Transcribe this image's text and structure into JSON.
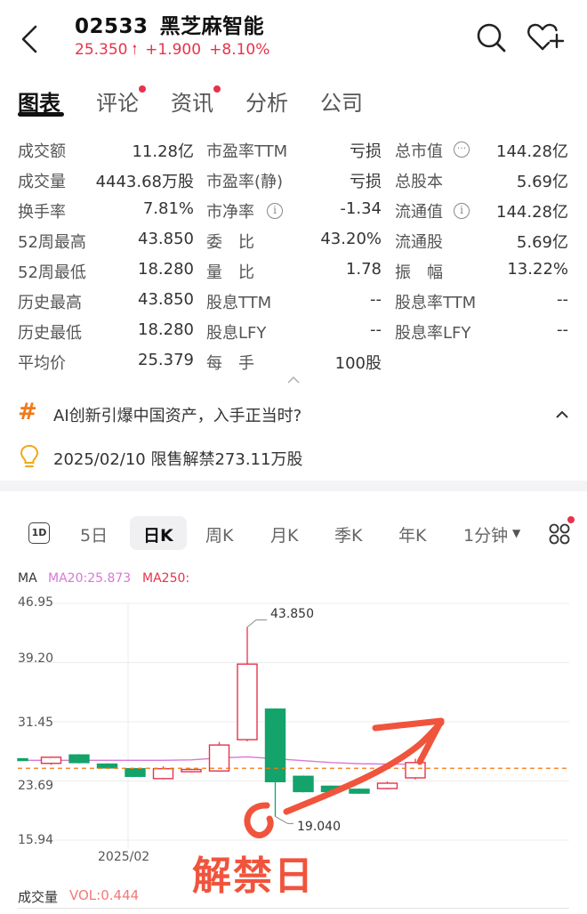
{
  "header": {
    "code": "02533",
    "name": "黑芝麻智能",
    "price": "25.350",
    "change": "+1.900",
    "change_pct": "+8.10%"
  },
  "tabs": [
    {
      "label": "图表",
      "active": true,
      "dot": false
    },
    {
      "label": "评论",
      "active": false,
      "dot": true
    },
    {
      "label": "资讯",
      "active": false,
      "dot": true
    },
    {
      "label": "分析",
      "active": false,
      "dot": false
    },
    {
      "label": "公司",
      "active": false,
      "dot": false
    }
  ],
  "stats": [
    [
      {
        "label": "成交额",
        "value": "11.28亿"
      },
      {
        "label": "市盈率TTM",
        "value": "亏损"
      },
      {
        "label": "总市值",
        "value": "144.28亿"
      }
    ],
    [
      {
        "label": "成交量",
        "value": "4443.68万股"
      },
      {
        "label": "市盈率(静)",
        "value": "亏损"
      },
      {
        "label": "总股本",
        "value": "5.69亿"
      }
    ],
    [
      {
        "label": "换手率",
        "value": "7.81%"
      },
      {
        "label": "市净率",
        "value": "-1.34"
      },
      {
        "label": "流通值",
        "value": "144.28亿"
      }
    ],
    [
      {
        "label": "52周最高",
        "value": "43.850"
      },
      {
        "label": "委　比",
        "value": "43.20%"
      },
      {
        "label": "流通股",
        "value": "5.69亿"
      }
    ],
    [
      {
        "label": "52周最低",
        "value": "18.280"
      },
      {
        "label": "量　比",
        "value": "1.78"
      },
      {
        "label": "振　幅",
        "value": "13.22%"
      }
    ],
    [
      {
        "label": "历史最高",
        "value": "43.850"
      },
      {
        "label": "股息TTM",
        "value": "--"
      },
      {
        "label": "股息率TTM",
        "value": "--"
      }
    ],
    [
      {
        "label": "历史最低",
        "value": "18.280"
      },
      {
        "label": "股息LFY",
        "value": "--"
      },
      {
        "label": "股息率LFY",
        "value": "--"
      }
    ],
    [
      {
        "label": "平均价",
        "value": "25.379"
      },
      {
        "label": "每　手",
        "value": "100股"
      }
    ]
  ],
  "notices": {
    "topic": "AI创新引爆中国资产，入手正当时?",
    "event": "2025/02/10 限售解禁273.11万股"
  },
  "periods": [
    "1D",
    "5日",
    "日K",
    "周K",
    "月K",
    "季K",
    "年K",
    "1分钟"
  ],
  "indicator": {
    "ma_label": "MA",
    "ma20": "MA20:25.873",
    "ma250": "MA250:",
    "volume_label": "成交量",
    "volume_value": "VOL:0.444"
  },
  "annotation": {
    "text": "解禁日"
  },
  "colors": {
    "up": "#e6334b",
    "down": "#13a36b",
    "ma20": "#d877d8",
    "accent": "#f0543c"
  },
  "chart_data": {
    "type": "candlestick",
    "y_ticks": [
      "46.95",
      "39.20",
      "31.45",
      "23.69",
      "15.94"
    ],
    "ylim": [
      15.94,
      46.95
    ],
    "x_tick_label": "2025/02",
    "high_label": "43.850",
    "low_label": "19.040",
    "last_price": 25.35,
    "candles": [
      {
        "o": 26.6,
        "c": 26.6,
        "h": 26.6,
        "l": 26.6,
        "dir": "down",
        "partial": true
      },
      {
        "o": 26.0,
        "c": 26.8,
        "h": 26.9,
        "l": 25.8,
        "dir": "up"
      },
      {
        "o": 27.1,
        "c": 26.1,
        "h": 27.2,
        "l": 26.0,
        "dir": "down"
      },
      {
        "o": 25.9,
        "c": 25.4,
        "h": 26.0,
        "l": 25.3,
        "dir": "down"
      },
      {
        "o": 25.3,
        "c": 24.3,
        "h": 25.4,
        "l": 24.2,
        "dir": "down"
      },
      {
        "o": 24.0,
        "c": 25.3,
        "h": 25.6,
        "l": 23.9,
        "dir": "up"
      },
      {
        "o": 24.9,
        "c": 25.2,
        "h": 25.3,
        "l": 24.8,
        "dir": "up"
      },
      {
        "o": 25.0,
        "c": 28.4,
        "h": 28.8,
        "l": 24.9,
        "dir": "up"
      },
      {
        "o": 29.1,
        "c": 39.0,
        "h": 43.85,
        "l": 28.9,
        "dir": "up"
      },
      {
        "o": 33.1,
        "c": 23.6,
        "h": 33.2,
        "l": 19.04,
        "dir": "down"
      },
      {
        "o": 24.3,
        "c": 22.3,
        "h": 24.4,
        "l": 22.2,
        "dir": "down"
      },
      {
        "o": 23.0,
        "c": 22.3,
        "h": 23.1,
        "l": 22.1,
        "dir": "down"
      },
      {
        "o": 22.6,
        "c": 22.1,
        "h": 22.7,
        "l": 22.0,
        "dir": "down"
      },
      {
        "o": 22.7,
        "c": 23.4,
        "h": 23.6,
        "l": 22.6,
        "dir": "up"
      },
      {
        "o": 24.1,
        "c": 26.1,
        "h": 26.6,
        "l": 23.9,
        "dir": "up"
      }
    ],
    "ma20": [
      26.4,
      26.4,
      26.4,
      26.4,
      26.4,
      26.4,
      26.45,
      26.7,
      26.85,
      26.6,
      26.35,
      26.1,
      25.95,
      25.9,
      25.88
    ]
  }
}
